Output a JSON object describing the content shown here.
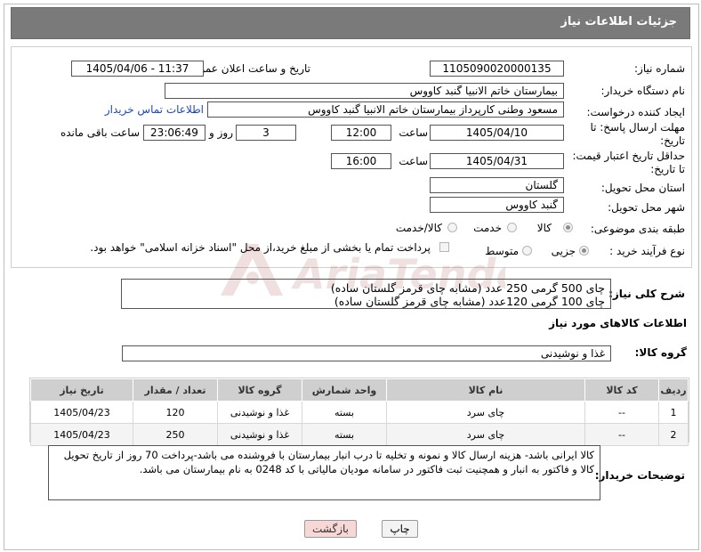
{
  "header": {
    "title": "جزئیات اطلاعات نیاز"
  },
  "fields": {
    "need_number_label": "شماره نیاز:",
    "need_number": "1105090020000135",
    "announce_label": "تاریخ و ساعت اعلان عمومی:",
    "announce_value": "1405/04/06 - 11:37",
    "buyer_org_label": "نام دستگاه خریدار:",
    "buyer_org": "بیمارستان خاتم الانبیا گنبد کاووس",
    "requester_label": "ایجاد کننده درخواست:",
    "requester": "مسعود وطنی کارپرداز بیمارستان خاتم الانبیا گنبد کاووس",
    "buyer_contact_link": "اطلاعات تماس خریدار",
    "deadline_label_1": "مهلت ارسال پاسخ: تا",
    "deadline_label_2": "تاریخ:",
    "deadline_date": "1405/04/10",
    "time_label": "ساعت",
    "deadline_time": "12:00",
    "days_value": "3",
    "days_label": "روز و",
    "remaining_time": "23:06:49",
    "remaining_label": "ساعت باقی مانده",
    "price_label_1": "حداقل تاریخ اعتبار قیمت:",
    "price_label_2": "تا تاریخ:",
    "price_date": "1405/04/31",
    "price_time": "16:00",
    "province_label": "استان محل تحویل:",
    "province": "گلستان",
    "city_label": "شهر محل تحویل:",
    "city": "گنبد کاووس",
    "category_label": "طبقه بندی موضوعی:",
    "category_options": [
      "کالا",
      "خدمت",
      "کالا/خدمت"
    ],
    "process_label": "نوع فرآیند خرید :",
    "process_options": [
      "جزیی",
      "متوسط"
    ],
    "payment_note": "پرداخت تمام یا بخشی از مبلغ خرید،از محل \"اسناد خزانه اسلامی\" خواهد بود."
  },
  "description": {
    "label": "شرح کلی نیاز:",
    "lines": [
      "چای 500 گرمی 250 عدد (مشابه چای قرمز گلستان ساده)",
      "چای 100 گرمی 120عدد (مشابه چای قرمز گلستان ساده)"
    ]
  },
  "goods": {
    "section_title": "اطلاعات کالاهای مورد نیاز",
    "group_label": "گروه کالا:",
    "group_value": "غذا و نوشیدنی",
    "columns": [
      "ردیف",
      "کد کالا",
      "نام کالا",
      "واحد شمارش",
      "گروه کالا",
      "تعداد / مقدار",
      "تاریخ نیاز"
    ],
    "rows": [
      [
        "1",
        "--",
        "چای سرد",
        "بسته",
        "غذا و نوشیدنی",
        "120",
        "1405/04/23"
      ],
      [
        "2",
        "--",
        "چای سرد",
        "بسته",
        "غذا و نوشیدنی",
        "250",
        "1405/04/23"
      ]
    ]
  },
  "notes": {
    "label": "توضیحات خریدار:",
    "text": "کالا ایرانی باشد- هزینه ارسال کالا و نمونه و تخلیه تا درب انبار بیمارستان با فروشنده می باشد-پرداخت 70 روز از تاریخ تحویل کالا و فاکتور به انبار و همچنیت ثبت فاکتور در سامانه مودیان مالیاتی با کد 0248 به نام بیمارستان می باشد."
  },
  "buttons": {
    "print": "چاپ",
    "back": "بازگشت"
  },
  "watermark": {
    "text": "AriaTender.net"
  },
  "colors": {
    "header_bg": "#7a7a7a",
    "link": "#1a49b5",
    "back_button_bg": "#f8d7d7",
    "table_header_bg": "#cfcfcf"
  }
}
